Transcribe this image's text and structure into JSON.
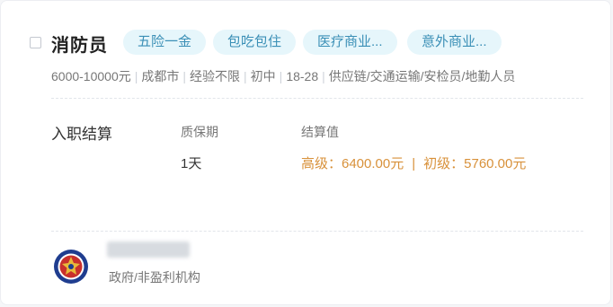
{
  "job": {
    "title": "消防员",
    "tags": [
      "五险一金",
      "包吃包住",
      "医疗商业...",
      "意外商业..."
    ],
    "meta": {
      "salary": "6000-10000元",
      "city": "成都市",
      "experience": "经验不限",
      "education": "初中",
      "age": "18-28",
      "category": "供应链/交通运输/安检员/地勤人员"
    }
  },
  "settlement": {
    "section_title": "入职结算",
    "warranty_label": "质保期",
    "warranty_value": "1天",
    "value_label": "结算值",
    "senior": "高级：6400.00元",
    "separator": "|",
    "junior": "初级：5760.00元"
  },
  "company": {
    "type": "政府/非盈利机构"
  },
  "colors": {
    "tag_bg": "#e6f6fb",
    "tag_text": "#3a8fb6",
    "settlement_value": "#d8913a"
  },
  "icons": {
    "logo": "fire-rescue-emblem-icon"
  }
}
